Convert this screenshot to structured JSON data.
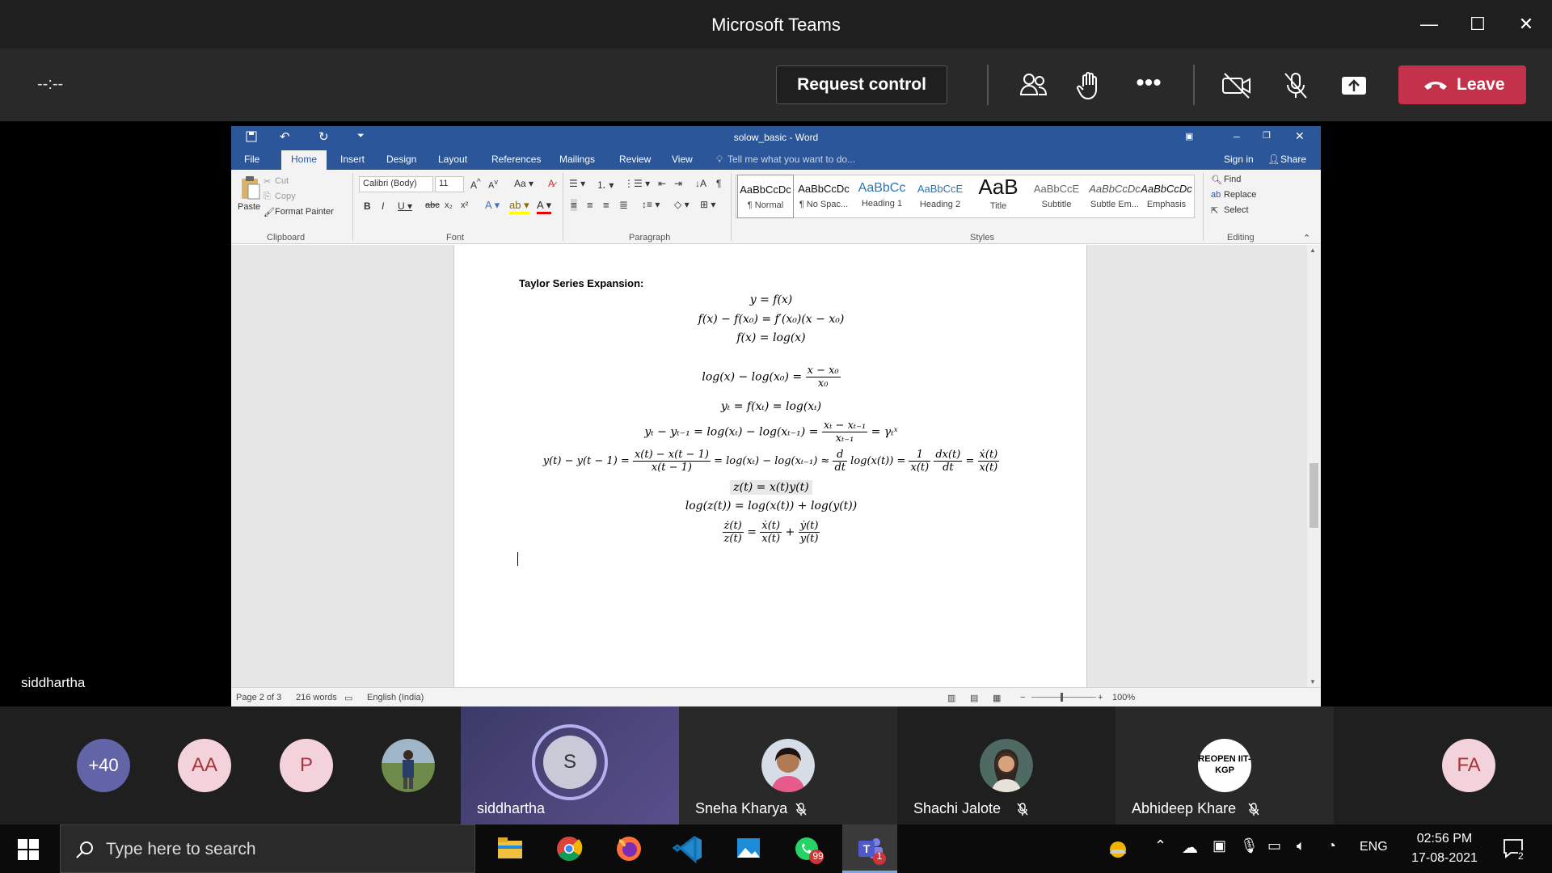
{
  "window": {
    "title": "Microsoft Teams"
  },
  "meeting": {
    "timer": "--:--",
    "request_control": "Request control",
    "leave": "Leave",
    "presenter": "siddhartha"
  },
  "word": {
    "title": "solow_basic - Word",
    "tabs": [
      "File",
      "Home",
      "Insert",
      "Design",
      "Layout",
      "References",
      "Mailings",
      "Review",
      "View"
    ],
    "tell_me": "Tell me what you want to do...",
    "sign_in": "Sign in",
    "share": "Share",
    "clipboard": {
      "paste": "Paste",
      "cut": "Cut",
      "copy": "Copy",
      "format_painter": "Format Painter",
      "label": "Clipboard"
    },
    "font": {
      "name": "Calibri (Body)",
      "size": "11",
      "label": "Font"
    },
    "paragraph_label": "Paragraph",
    "styles": {
      "label": "Styles",
      "items": [
        {
          "preview": "AaBbCcDc",
          "name": "¶ Normal"
        },
        {
          "preview": "AaBbCcDc",
          "name": "¶ No Spac..."
        },
        {
          "preview": "AaBbCc",
          "name": "Heading 1"
        },
        {
          "preview": "AaBbCcE",
          "name": "Heading 2"
        },
        {
          "preview": "AaB",
          "name": "Title"
        },
        {
          "preview": "AaBbCcE",
          "name": "Subtitle"
        },
        {
          "preview": "AaBbCcDc",
          "name": "Subtle Em..."
        },
        {
          "preview": "AaBbCcDc",
          "name": "Emphasis"
        }
      ]
    },
    "editing": {
      "find": "Find",
      "replace": "Replace",
      "select": "Select",
      "label": "Editing"
    },
    "document": {
      "heading": "Taylor Series Expansion:",
      "eq1": "y = f(x)",
      "eq2": "f(x) − f(x₀) = f′(x₀)(x − x₀)",
      "eq3": "f(x) = log(x)",
      "eq4_left": "log(x) − log(x₀) =",
      "eq4_num": "x − x₀",
      "eq4_den": "x₀",
      "eq5": "yₜ = f(xₜ) = log(xₜ)",
      "eq6_left": "yₜ − yₜ₋₁ = log(xₜ) − log(xₜ₋₁) =",
      "eq6_num": "xₜ − xₜ₋₁",
      "eq6_den": "xₜ₋₁",
      "eq6_right": "= γₜˣ",
      "eq7_a": "y(t) − y(t − 1) =",
      "eq7_num1": "x(t) − x(t − 1)",
      "eq7_den1": "x(t − 1)",
      "eq7_b": "= log(xₜ) − log(xₜ₋₁) ≈",
      "eq7_num2": "d",
      "eq7_den2": "dt",
      "eq7_c": "log(x(t)) =",
      "eq7_num3": "1",
      "eq7_den3": "x(t)",
      "eq7_num4": "dx(t)",
      "eq7_den4": "dt",
      "eq7_d": "=",
      "eq7_num5": "ẋ(t)",
      "eq7_den5": "x(t)",
      "eq8": "z(t) = x(t)y(t)",
      "eq9": "log(z(t)) = log(x(t)) + log(y(t))",
      "eq10_num1": "ż(t)",
      "eq10_den1": "z(t)",
      "eq10_num2": "ẋ(t)",
      "eq10_den2": "x(t)",
      "eq10_num3": "ẏ(t)",
      "eq10_den3": "y(t)"
    },
    "status": {
      "page": "Page 2 of 3",
      "words": "216 words",
      "language": "English (India)",
      "zoom": "100%"
    }
  },
  "participants": [
    {
      "initials": "+40",
      "color": "#6264a7",
      "text_color": "#ffffff"
    },
    {
      "initials": "AA",
      "color": "#f4d2dc",
      "text_color": "#a4373a"
    },
    {
      "initials": "P",
      "color": "#f4d2dc",
      "text_color": "#a4373a"
    },
    {
      "initials": "",
      "photo": true
    },
    {
      "initials": "S",
      "name": "siddhartha",
      "active": true
    },
    {
      "name": "Sneha Kharya",
      "muted": true
    },
    {
      "name": "Shachi Jalote",
      "muted": true
    },
    {
      "initials": "REOPEN IIT-KGP",
      "name": "Abhideep Khare",
      "muted": true
    },
    {
      "initials": "FA",
      "color": "#f4d2dc",
      "text_color": "#a4373a"
    }
  ],
  "taskbar": {
    "search_placeholder": "Type here to search",
    "whatsapp_badge": "99",
    "teams_badge": "1",
    "language": "ENG",
    "time": "02:56 PM",
    "date": "17-08-2021",
    "notifications": "2"
  }
}
